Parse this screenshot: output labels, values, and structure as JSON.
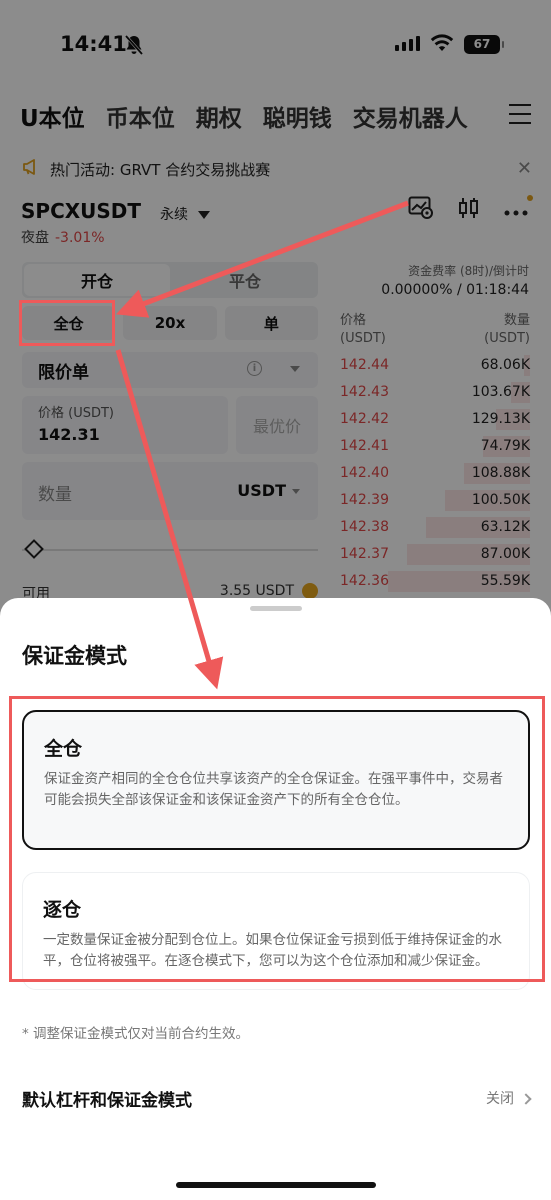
{
  "status": {
    "time": "14:41",
    "battery": "67"
  },
  "tabs": [
    "U本位",
    "币本位",
    "期权",
    "聪明钱",
    "交易机器人"
  ],
  "banner": {
    "text": "热门活动: GRVT 合约交易挑战赛"
  },
  "symbol": {
    "name": "SPCXUSDT",
    "type": "永续",
    "session": "夜盘",
    "change": "-3.01%"
  },
  "trade": {
    "open": "开仓",
    "close": "平仓",
    "margin_mode": "全仓",
    "leverage": "20x",
    "position_mode": "单",
    "order_type": "限价单",
    "price_label": "价格 (USDT)",
    "price_value": "142.31",
    "best_price": "最优价",
    "qty_placeholder": "数量",
    "qty_unit": "USDT",
    "avail_label": "可用",
    "avail_value": "3.55 USDT"
  },
  "funding": {
    "label": "资金费率 (8时)/倒计时",
    "value": "0.00000% / 01:18:44"
  },
  "orderbook": {
    "price_header": "价格",
    "price_unit": "(USDT)",
    "qty_header": "数量",
    "qty_unit": "(USDT)",
    "asks": [
      {
        "price": "142.44",
        "qty": "68.06K",
        "depth": 0.03
      },
      {
        "price": "142.43",
        "qty": "103.67K",
        "depth": 0.1
      },
      {
        "price": "142.42",
        "qty": "129.13K",
        "depth": 0.18
      },
      {
        "price": "142.41",
        "qty": "74.79K",
        "depth": 0.25
      },
      {
        "price": "142.40",
        "qty": "108.88K",
        "depth": 0.35
      },
      {
        "price": "142.39",
        "qty": "100.50K",
        "depth": 0.45
      },
      {
        "price": "142.38",
        "qty": "63.12K",
        "depth": 0.55
      },
      {
        "price": "142.37",
        "qty": "87.00K",
        "depth": 0.65
      },
      {
        "price": "142.36",
        "qty": "55.59K",
        "depth": 0.75
      }
    ]
  },
  "sheet": {
    "title": "保证金模式",
    "cross": {
      "title": "全仓",
      "desc": "保证金资产相同的全仓仓位共享该资产的全仓保证金。在强平事件中，交易者可能会损失全部该保证金和该保证金资产下的所有全仓仓位。"
    },
    "isolated": {
      "title": "逐仓",
      "desc": "一定数量保证金被分配到仓位上。如果仓位保证金亏损到低于维持保证金的水平，仓位将被强平。在逐仓模式下，您可以为这个仓位添加和减少保证金。"
    },
    "note": "* 调整保证金模式仅对当前合约生效。",
    "default_label": "默认杠杆和保证金模式",
    "default_value": "关闭"
  },
  "colors": {
    "annotation": "#ee5a5a",
    "ask": "#e04848"
  }
}
